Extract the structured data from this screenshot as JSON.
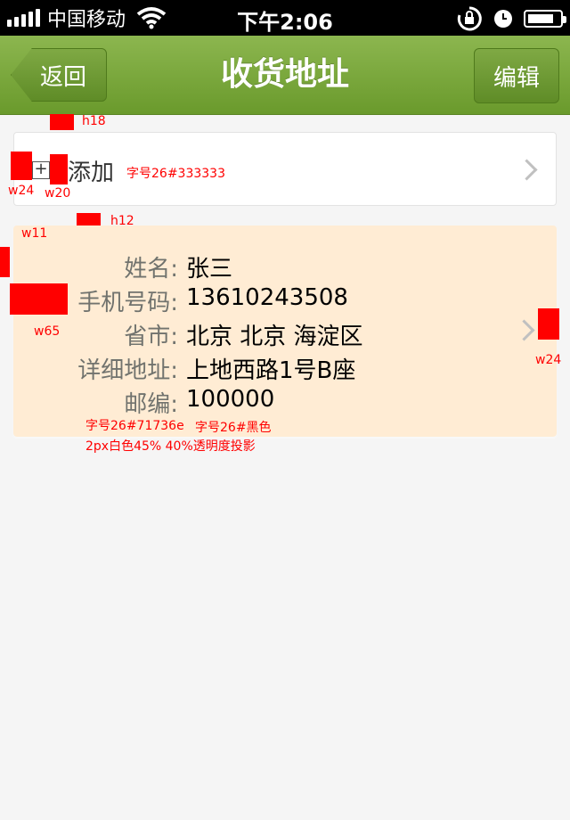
{
  "status_bar": {
    "carrier": "中国移动",
    "time": "下午2:06"
  },
  "nav": {
    "back_label": "返回",
    "title": "收货地址",
    "edit_label": "编辑"
  },
  "add_row": {
    "label": "添加"
  },
  "address": {
    "rows": [
      {
        "label": "姓名:",
        "value": "张三"
      },
      {
        "label": "手机号码:",
        "value": "13610243508"
      },
      {
        "label": "省市:",
        "value": "北京 北京 海淀区"
      },
      {
        "label": "详细地址:",
        "value": "上地西路1号B座"
      },
      {
        "label": "邮编:",
        "value": "100000"
      }
    ]
  },
  "annotations": {
    "h18": "h18",
    "w24_left": "w24",
    "w20": "w20",
    "add_font": "字号26#333333",
    "h12": "h12",
    "w11": "w11",
    "w65": "w65",
    "w24_right": "w24",
    "label_font": "字号26#71736e",
    "value_font": "字号26#黑色",
    "shadow": "2px白色45% 40%透明度投影"
  },
  "colors": {
    "nav_green": "#7aa83c",
    "card_bg": "#ffecd4",
    "label_color": "#71736e",
    "add_text_color": "#333333",
    "annotation_red": "#ff0000"
  }
}
